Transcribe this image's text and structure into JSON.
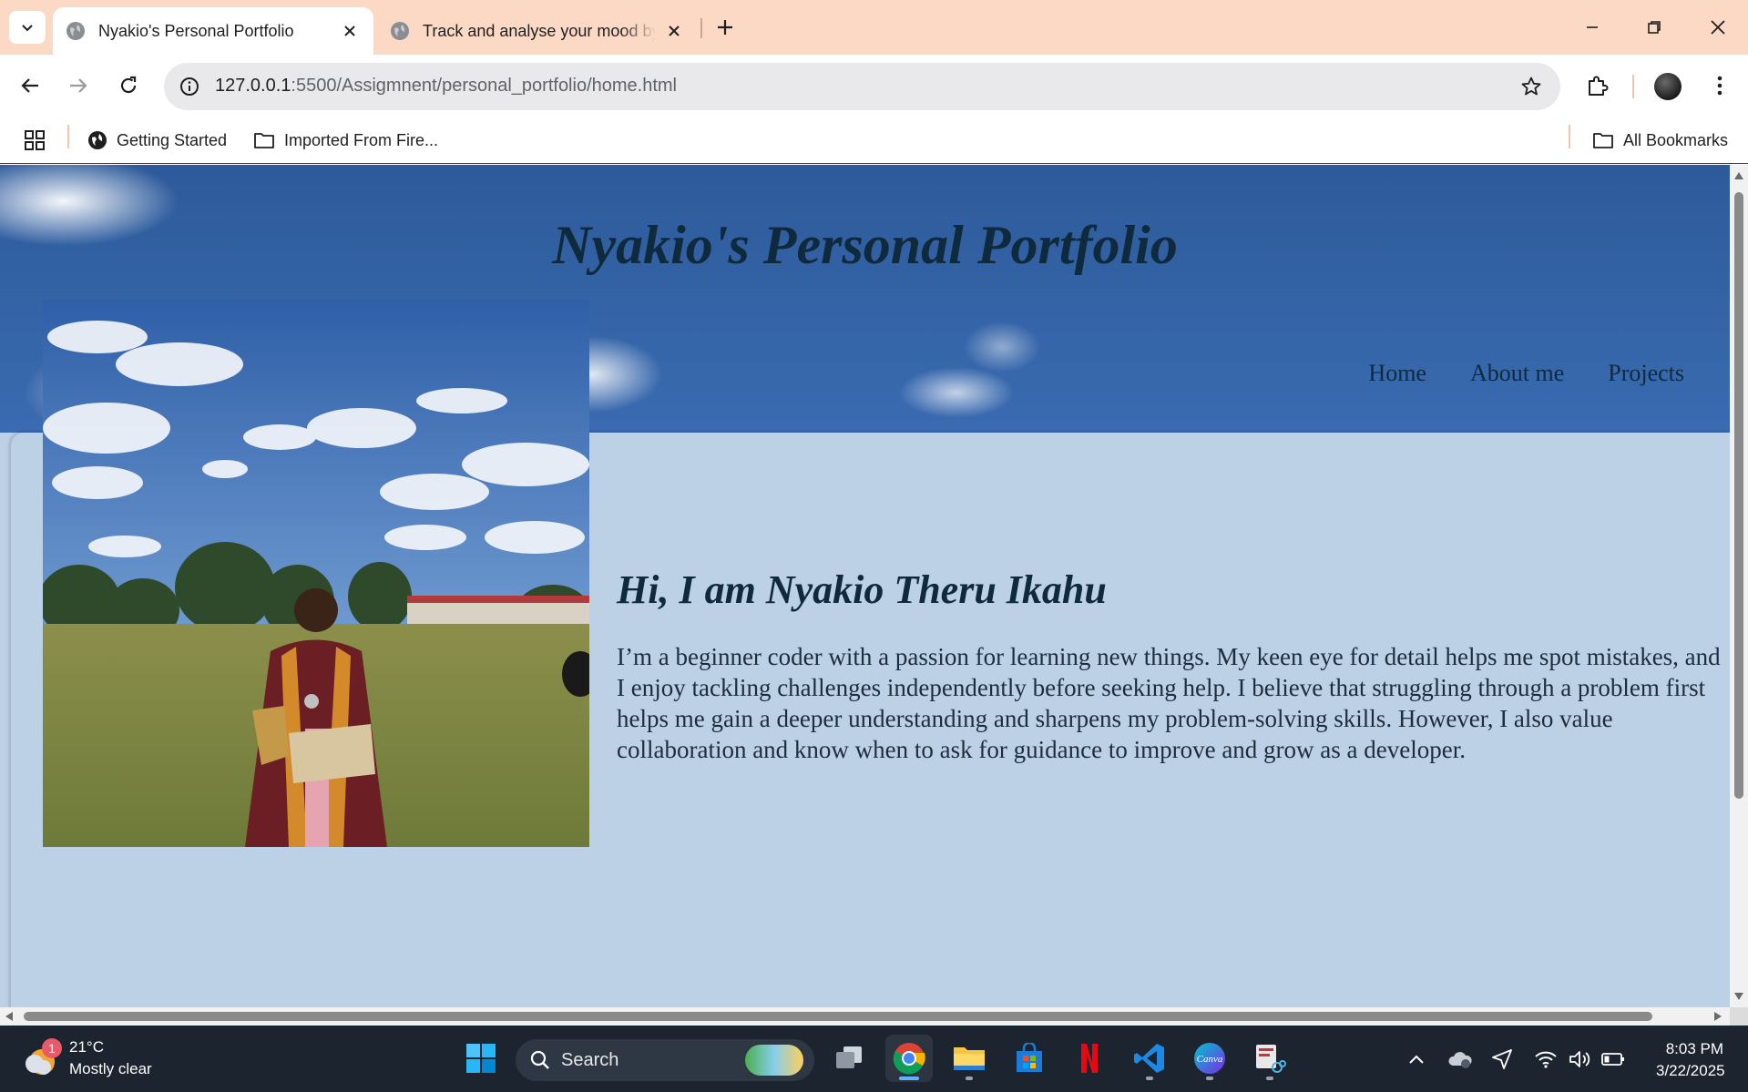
{
  "browser": {
    "tabs": [
      {
        "title": "Nyakio's Personal Portfolio",
        "active": true
      },
      {
        "title": "Track and analyse your mood by",
        "active": false
      }
    ],
    "url": {
      "host": "127.0.0.1",
      "path": ":5500/Assigmnent/personal_portfolio/home.html"
    },
    "bookmarks": [
      {
        "label": "Getting Started",
        "icon": "globe-icon"
      },
      {
        "label": "Imported From Fire...",
        "icon": "folder-icon"
      }
    ],
    "all_bookmarks_label": "All Bookmarks"
  },
  "page": {
    "site_title": "Nyakio's Personal Portfolio",
    "nav": [
      "Home",
      "About me",
      "Projects"
    ],
    "intro_heading": "Hi, I am Nyakio Theru Ikahu",
    "intro_text": "I’m a beginner coder with a passion for learning new things. My keen eye for detail helps me spot mistakes, and I enjoy tackling challenges independently before seeking help. I believe that struggling through a problem first helps me gain a deeper understanding and sharpens my problem-solving skills. However, I also value collaboration and know when to ask for guidance to improve and grow as a developer."
  },
  "taskbar": {
    "weather": {
      "temp": "21°C",
      "condition": "Mostly clear",
      "badge": "1"
    },
    "search_placeholder": "Search",
    "time": "8:03 PM",
    "date": "3/22/2025"
  },
  "colors": {
    "tabstrip": "#fcd9c4",
    "page_bg": "#bcd0e6",
    "heading": "#0f2a3d",
    "taskbar": "#1c2430"
  }
}
